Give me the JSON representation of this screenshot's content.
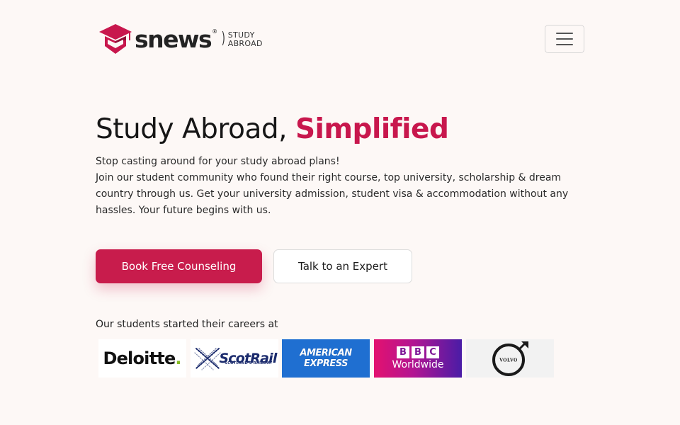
{
  "header": {
    "logo": {
      "wordmark": "snews",
      "registered": "®",
      "separator": ")",
      "sub_line1": "STUDY",
      "sub_line2": "ABROAD",
      "brand_color": "#c8174d"
    },
    "menu_icon": "hamburger-menu-icon"
  },
  "hero": {
    "title_plain": "Study Abroad,",
    "title_accent": "Simplified",
    "accent_color": "#c8174d",
    "line1": "Stop casting around for your study abroad plans!",
    "line2": "Join our student community who found their right course, top university, scholarship & dream country through us. Get your university admission, student visa & accommodation without any hassles. Your future begins with us."
  },
  "actions": {
    "primary_label": "Book Free Counseling",
    "secondary_label": "Talk to an Expert"
  },
  "careers": {
    "label": "Our students started their careers at",
    "logos": {
      "deloitte": {
        "text": "Deloitte",
        "dot": ".",
        "dot_color": "#86bc25"
      },
      "scotrail": {
        "text": "ScotRail",
        "sub": "SCOTLAND'S RAILWAY"
      },
      "amex": {
        "line1": "AMERICAN",
        "line2": "EXPRESS",
        "bg_color": "#1f6fd1"
      },
      "bbc": {
        "b1": "B",
        "b2": "B",
        "b3": "C",
        "line2": "Worldwide"
      },
      "volvo": {
        "text": "VOLVO"
      }
    }
  }
}
